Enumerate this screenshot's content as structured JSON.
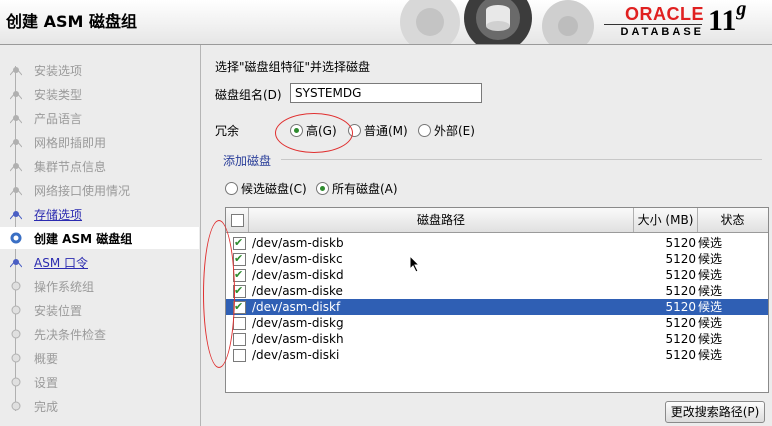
{
  "header": {
    "title": "创建 ASM 磁盘组",
    "brand_oracle": "ORACLE",
    "brand_database": "DATABASE",
    "version": "11",
    "version_sup": "g"
  },
  "steps": [
    {
      "label": "安装选项",
      "state": "done"
    },
    {
      "label": "安装类型",
      "state": "done"
    },
    {
      "label": "产品语言",
      "state": "done"
    },
    {
      "label": "网格即插即用",
      "state": "done"
    },
    {
      "label": "集群节点信息",
      "state": "done"
    },
    {
      "label": "网络接口使用情况",
      "state": "done"
    },
    {
      "label": "存储选项",
      "state": "link"
    },
    {
      "label": "创建 ASM 磁盘组",
      "state": "current"
    },
    {
      "label": "ASM 口令",
      "state": "link"
    },
    {
      "label": "操作系统组",
      "state": "pending"
    },
    {
      "label": "安装位置",
      "state": "pending"
    },
    {
      "label": "先决条件检查",
      "state": "pending"
    },
    {
      "label": "概要",
      "state": "pending"
    },
    {
      "label": "设置",
      "state": "pending"
    },
    {
      "label": "完成",
      "state": "pending"
    }
  ],
  "form": {
    "prompt": "选择\"磁盘组特征\"并选择磁盘",
    "disk_group_name_label": "磁盘组名(D)",
    "disk_group_name_value": "SYSTEMDG",
    "redundancy_label": "冗余",
    "redundancy_options": [
      {
        "label": "高(G)",
        "selected": true
      },
      {
        "label": "普通(M)",
        "selected": false
      },
      {
        "label": "外部(E)",
        "selected": false
      }
    ],
    "add_disks_label": "添加磁盘",
    "filter_options": [
      {
        "label": "候选磁盘(C)",
        "selected": false
      },
      {
        "label": "所有磁盘(A)",
        "selected": true
      }
    ],
    "change_path_button": "更改搜索路径(P)"
  },
  "table": {
    "columns": [
      "磁盘路径",
      "大小 (MB)",
      "状态"
    ],
    "rows": [
      {
        "checked": true,
        "path": "/dev/asm-diskb",
        "size": "5120",
        "status": "候选",
        "selected": false
      },
      {
        "checked": true,
        "path": "/dev/asm-diskc",
        "size": "5120",
        "status": "候选",
        "selected": false
      },
      {
        "checked": true,
        "path": "/dev/asm-diskd",
        "size": "5120",
        "status": "候选",
        "selected": false
      },
      {
        "checked": true,
        "path": "/dev/asm-diske",
        "size": "5120",
        "status": "候选",
        "selected": false
      },
      {
        "checked": true,
        "path": "/dev/asm-diskf",
        "size": "5120",
        "status": "候选",
        "selected": true
      },
      {
        "checked": false,
        "path": "/dev/asm-diskg",
        "size": "5120",
        "status": "候选",
        "selected": false
      },
      {
        "checked": false,
        "path": "/dev/asm-diskh",
        "size": "5120",
        "status": "候选",
        "selected": false
      },
      {
        "checked": false,
        "path": "/dev/asm-diski",
        "size": "5120",
        "status": "候选",
        "selected": false
      }
    ]
  },
  "colors": {
    "accent": "#2f5fb4",
    "annotation": "#e03030",
    "oracle_red": "#e02020"
  }
}
